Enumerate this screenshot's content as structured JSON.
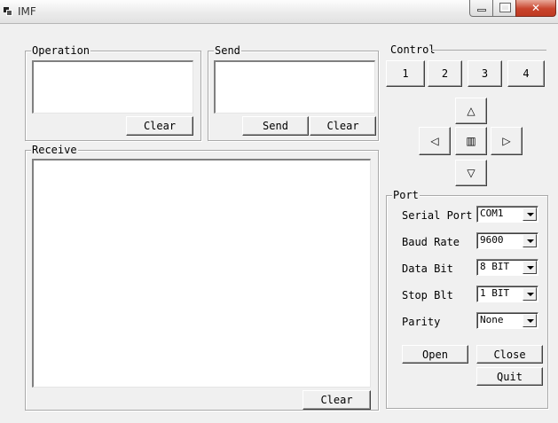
{
  "window": {
    "title": "IMF",
    "close_glyph": "✕"
  },
  "operation": {
    "label": "Operation",
    "value": "",
    "clear_label": "Clear"
  },
  "send": {
    "label": "Send",
    "value": "",
    "send_label": "Send",
    "clear_label": "Clear"
  },
  "receive": {
    "label": "Receive",
    "value": "",
    "clear_label": "Clear"
  },
  "control": {
    "label": "Control",
    "buttons": [
      "1",
      "2",
      "3",
      "4"
    ],
    "up": "△",
    "left": "◁",
    "center": "▥",
    "right": "▷",
    "down": "▽"
  },
  "port": {
    "label": "Port",
    "serial_port_label": "Serial Port",
    "serial_port_value": "COM1",
    "baud_rate_label": "Baud Rate",
    "baud_rate_value": "9600",
    "data_bit_label": "Data Bit",
    "data_bit_value": "8 BIT",
    "stop_bit_label": "Stop Blt",
    "stop_bit_value": "1 BIT",
    "parity_label": "Parity",
    "parity_value": "None",
    "open_label": "Open",
    "close_label": "Close",
    "quit_label": "Quit"
  }
}
